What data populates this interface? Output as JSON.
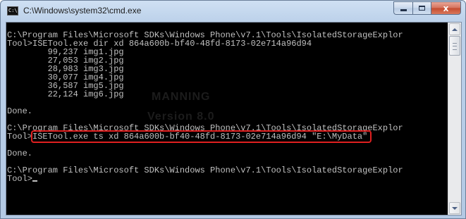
{
  "window": {
    "title": "C:\\Windows\\system32\\cmd.exe",
    "icon_label": "C:\\"
  },
  "caption_buttons": {
    "minimize_icon": "minimize-icon",
    "maximize_icon": "maximize-icon",
    "close_label": "x"
  },
  "console": {
    "lines": [
      "C:\\Program Files\\Microsoft SDKs\\Windows Phone\\v7.1\\Tools\\IsolatedStorageExplor",
      "Tool>ISETool.exe dir xd 864a600b-bf40-48fd-8173-02e714a96d94",
      "        99,237 img1.jpg",
      "        27,053 img2.jpg",
      "        28,983 img3.jpg",
      "        30,077 img4.jpg",
      "        36,587 img5.jpg",
      "        22,124 img6.jpg",
      "",
      "Done.",
      "",
      "C:\\Program Files\\Microsoft SDKs\\Windows Phone\\v7.1\\Tools\\IsolatedStorageExplor",
      "Tool>",
      "",
      "Done.",
      "",
      "C:\\Program Files\\Microsoft SDKs\\Windows Phone\\v7.1\\Tools\\IsolatedStorageExplor",
      "Tool>"
    ],
    "highlighted_command": "ISETool.exe ts xd 864a600b-bf40-48fd-8173-02e714a96d94 \"E:\\MyData\"",
    "highlight_color": "#e02020",
    "text_color": "#c0c0c0",
    "background_color": "#000000"
  },
  "watermark": {
    "line1": "MANNING",
    "line2": "Version 8.0"
  },
  "scrollbar": {
    "up_icon": "scroll-up-arrow-icon",
    "down_icon": "scroll-down-arrow-icon"
  }
}
